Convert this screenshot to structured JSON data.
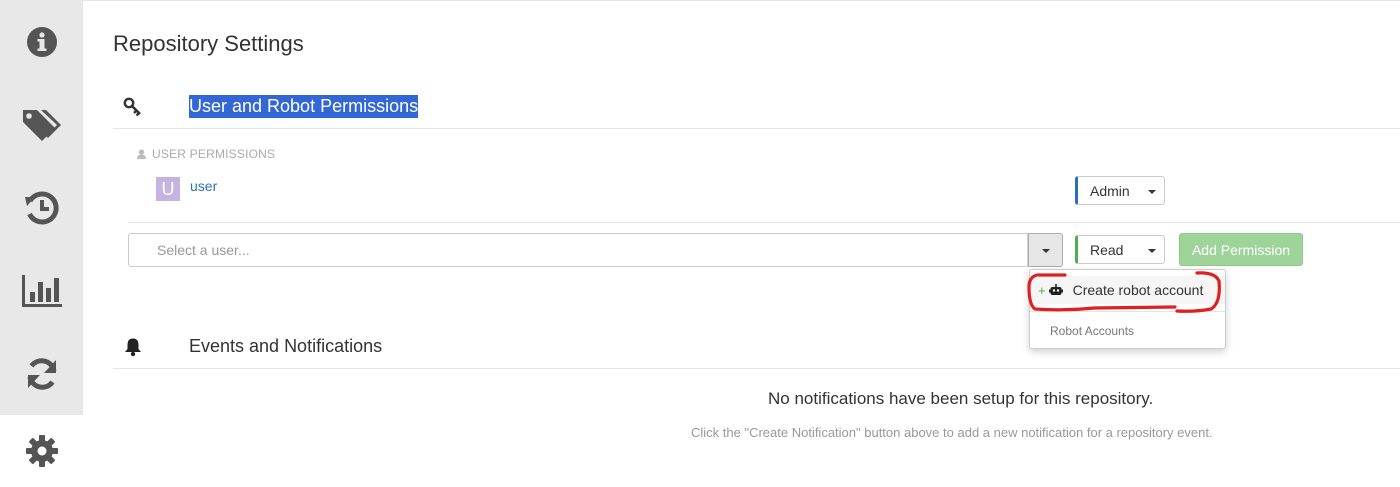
{
  "sidebar": {
    "items": [
      {
        "icon": "info-icon",
        "active": false
      },
      {
        "icon": "tags-icon",
        "active": false
      },
      {
        "icon": "history-icon",
        "active": false
      },
      {
        "icon": "bar-chart-icon",
        "active": false
      },
      {
        "icon": "refresh-icon",
        "active": false
      },
      {
        "icon": "gear-icon",
        "active": true
      }
    ]
  },
  "page": {
    "title": "Repository Settings"
  },
  "permissions": {
    "section_title": "User and Robot Permissions",
    "user_permissions_label": "USER PERMISSIONS",
    "users": [
      {
        "avatar_letter": "U",
        "name": "user",
        "role": "Admin"
      }
    ],
    "add_form": {
      "placeholder": "Select a user...",
      "role": "Read",
      "add_button_label": "Add Permission"
    },
    "dropdown": {
      "create_robot_label": "Create robot account",
      "robot_accounts_header": "Robot Accounts"
    }
  },
  "notifications": {
    "section_title": "Events and Notifications",
    "empty_title": "No notifications have been setup for this repository.",
    "empty_subtitle": "Click the \"Create Notification\" button above to add a new notification for a repository event."
  },
  "colors": {
    "accent_blue": "#2a6fbd",
    "success_green": "#4cae4c",
    "add_button_bg": "#9ed49a",
    "highlight": "#3367d6",
    "annotation_red": "#e02020"
  }
}
